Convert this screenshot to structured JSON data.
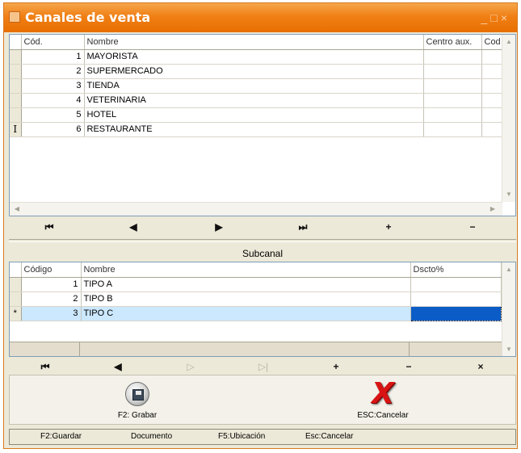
{
  "window": {
    "title": "Canales de venta",
    "controls": [
      "_",
      "□",
      "×"
    ]
  },
  "channels_grid": {
    "columns": [
      "Cód.",
      "Nombre",
      "Centro aux.",
      "Cod"
    ],
    "rows": [
      {
        "code": "1",
        "name": "MAYORISTA"
      },
      {
        "code": "2",
        "name": "SUPERMERCADO"
      },
      {
        "code": "3",
        "name": "TIENDA"
      },
      {
        "code": "4",
        "name": "VETERINARIA"
      },
      {
        "code": "5",
        "name": "HOTEL"
      },
      {
        "code": "6",
        "name": "RESTAURANTE"
      }
    ],
    "active_row_marker": "I"
  },
  "channels_nav": {
    "first": "⏮",
    "prev": "◀",
    "next": "▶",
    "last": "⏭",
    "add": "+",
    "delete": "−"
  },
  "subchannel": {
    "caption": "Subcanal",
    "columns": [
      "Código",
      "Nombre",
      "Dscto%"
    ],
    "rows": [
      {
        "code": "1",
        "name": "TIPO A",
        "discount": ""
      },
      {
        "code": "2",
        "name": "TIPO B",
        "discount": ""
      },
      {
        "code": "3",
        "name": "TIPO C",
        "discount": ""
      }
    ],
    "new_row_marker": "*"
  },
  "subchannel_nav": {
    "first": "⏮",
    "prev": "◀",
    "next": "▷",
    "last": "▷|",
    "add": "+",
    "delete": "−",
    "cancel": "×"
  },
  "actions": {
    "save_label": "F2: Grabar",
    "cancel_label": "ESC:Cancelar",
    "cancel_glyph": "X"
  },
  "status": [
    "F2:Guardar",
    "Documento",
    "F5:Ubicación",
    "Esc:Cancelar"
  ],
  "colors": {
    "title_bar": "#f07f15",
    "active_row": "#cce8ff",
    "selected_cell": "#0b5cc6",
    "cancel_icon": "#d81414"
  }
}
